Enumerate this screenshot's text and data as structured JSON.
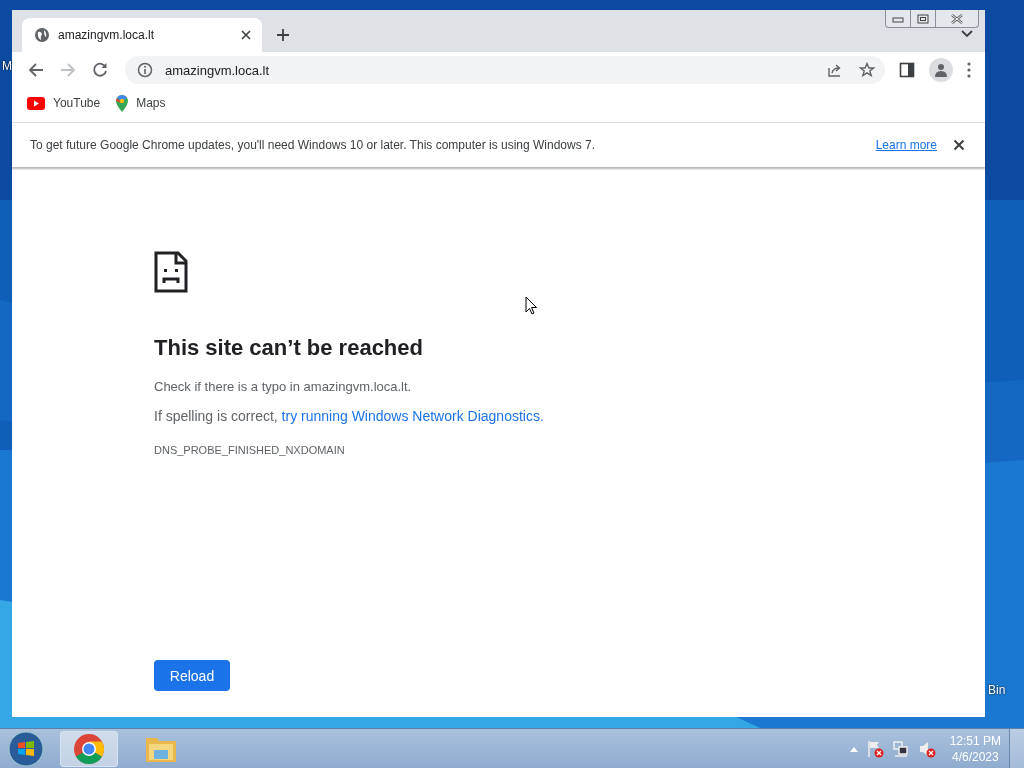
{
  "desktop": {
    "icon_labels": [
      {
        "text": "M"
      },
      {
        "text": "Bin"
      }
    ]
  },
  "browser": {
    "tabs": [
      {
        "title": "amazingvm.loca.lt",
        "selected": true
      }
    ],
    "nav": {
      "back_disabled": false,
      "forward_disabled": true
    },
    "address": "amazingvm.loca.lt",
    "bookmarks": [
      {
        "label": "YouTube",
        "kind": "youtube"
      },
      {
        "label": "Maps",
        "kind": "maps"
      }
    ],
    "infobar": {
      "message": "To get future Google Chrome updates, you'll need Windows 10 or later. This computer is using Windows 7.",
      "link": "Learn more"
    },
    "error_page": {
      "title": "This site can’t be reached",
      "hint": "Check if there is a typo in amazingvm.loca.lt.",
      "suggestion_prefix": "If spelling is correct, ",
      "suggestion_link": "try running Windows Network Diagnostics.",
      "code": "DNS_PROBE_FINISHED_NXDOMAIN",
      "button": "Reload"
    }
  },
  "taskbar": {
    "apps": [
      {
        "kind": "chrome",
        "selected": true
      },
      {
        "kind": "explorer",
        "selected": false
      }
    ],
    "clock": {
      "time": "12:51 PM",
      "date": "4/6/2023"
    }
  }
}
